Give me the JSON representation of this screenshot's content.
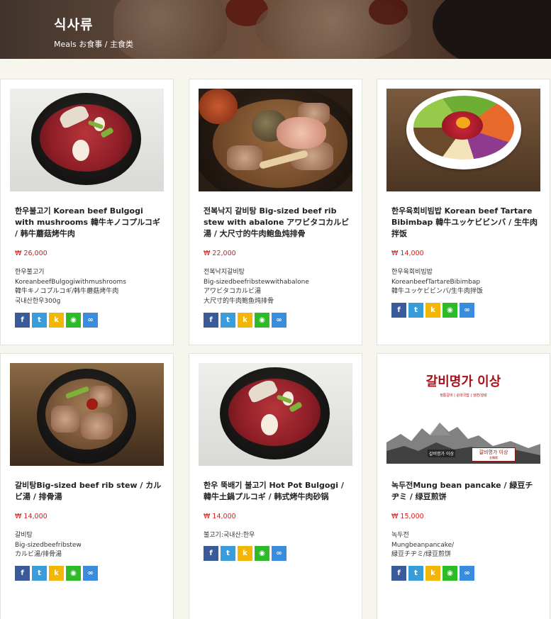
{
  "header": {
    "title": "식사류",
    "subtitle": "Meals お食事 / 主食类"
  },
  "currency_symbol": "₩",
  "colors": {
    "price": "#d0211c",
    "facebook": "#3b5a9a",
    "twitter": "#3a9ddb",
    "kakaostory": "#f2b606",
    "line": "#2dbb27",
    "link": "#3a8cde"
  },
  "share_icons": [
    "facebook-icon",
    "twitter-icon",
    "kakaostory-icon",
    "line-icon",
    "link-icon"
  ],
  "menu": [
    {
      "name": "한우불고기 Korean beef Bulgogi with mushrooms 韓牛キノコプルコギ / 韩牛蘑菇烤牛肉",
      "price": "₩ 26,000",
      "desc": [
        "한우불고기",
        "KoreanbeefBulgogiwithmushrooms",
        "韓牛キノコプルコギ/韩牛蘑菇烤牛肉",
        "국내산한우300g"
      ]
    },
    {
      "name": "전복낙지 갈비탕 Big-sized beef rib stew with abalone アワビタコカルビ湯 / 大尺寸的牛肉鲍鱼炖排骨",
      "price": "₩ 22,000",
      "desc": [
        "전복낙지갈비탕",
        "Big-sizedbeefribstewwithabalone",
        "アワビタコカルビ湯",
        "大尺寸的牛肉鲍鱼炖排骨"
      ]
    },
    {
      "name": "한우육회비빔밥 Korean beef Tartare Bibimbap 韓牛ユッケビビンバ / 生牛肉拌饭",
      "price": "₩ 14,000",
      "desc": [
        "한우육회비빔밥",
        "KoreanbeefTartareBibimbap",
        "韓牛ユッケビビンバ/生牛肉拌饭"
      ]
    },
    {
      "name": "갈비탕Big-sized beef rib stew / カルビ湯 / 排骨湯",
      "price": "₩ 14,000",
      "desc": [
        "갈비탕",
        "Big-sizedbeefribstew",
        "カルビ湯/排骨湯"
      ]
    },
    {
      "name": "한우 뚝배기 불고기 Hot Pot Bulgogi / 韓牛土鍋プルコギ / 韩式烤牛肉砂锅",
      "price": "₩ 14,000",
      "desc": [
        "불고기:국내산:한우"
      ]
    },
    {
      "name": "녹두전Mung bean pancake / 緑豆チヂミ / 绿豆煎饼",
      "price": "₩ 15,000",
      "desc": [
        "녹두전",
        "Mungbeanpancake/",
        "緑豆チヂミ/绿豆煎饼"
      ]
    }
  ],
  "logo_image": {
    "title": "갈비명가 이상",
    "tagline": "정통갈비 | 순대국밥 | 냉면/설렁",
    "seal_left": "갈비명가 이상",
    "seal_right": "갈비명가 이상",
    "seal_under": "金鵝館"
  }
}
